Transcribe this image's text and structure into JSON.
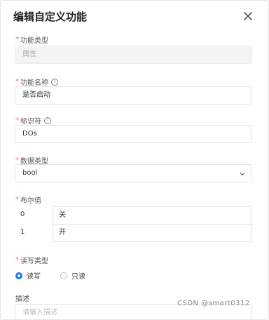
{
  "dialog": {
    "title": "编辑自定义功能"
  },
  "fields": {
    "type": {
      "label": "功能类型",
      "value": "属性"
    },
    "name": {
      "label": "功能名称",
      "value": "是否启动"
    },
    "identifier": {
      "label": "标识符",
      "value": "DOs"
    },
    "data_type": {
      "label": "数据类型",
      "value": "bool"
    },
    "enum": {
      "label": "布尔值",
      "rows": [
        {
          "key": "0",
          "text": "关"
        },
        {
          "key": "1",
          "text": "开"
        }
      ]
    },
    "rw_type": {
      "label": "读写类型",
      "options": [
        {
          "label": "读写",
          "selected": true
        },
        {
          "label": "只读",
          "selected": false
        }
      ]
    },
    "description": {
      "label": "描述",
      "placeholder": "请输入描述"
    }
  },
  "watermark": "CSDN @smart0312",
  "icons": {
    "close": "close-icon",
    "help": "help-icon",
    "dropdown": "chevron-down-icon"
  },
  "colors": {
    "accent": "#1677ff",
    "required": "#f56c6c"
  }
}
